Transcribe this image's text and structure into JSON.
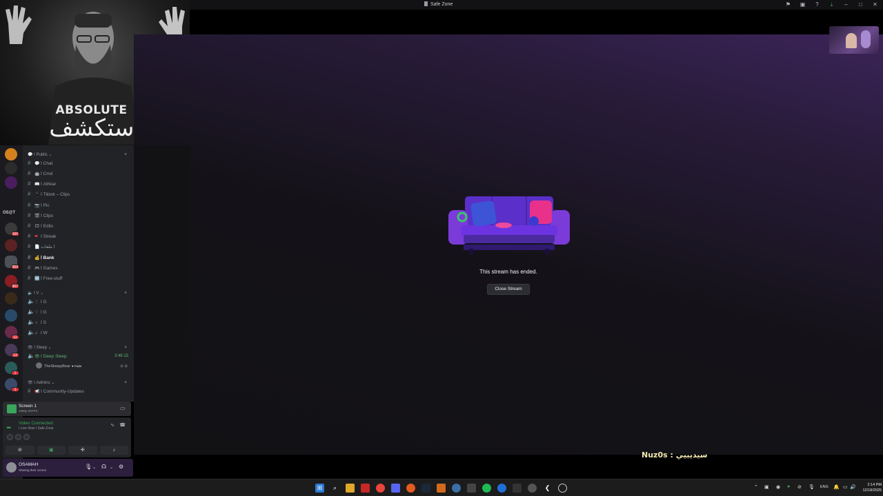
{
  "window": {
    "title": "Safe Zone",
    "title_icons": [
      "pin-icon",
      "inbox-icon",
      "help-icon",
      "download-icon",
      "minimize-icon",
      "maximize-icon",
      "close-icon"
    ]
  },
  "webcam": {
    "caption_en": "ABSOLUTE",
    "caption_ar": "استكشف"
  },
  "stream": {
    "ended_message": "This stream has ended.",
    "close_button": "Close Stream",
    "bottom_overlay": "Nuz0s : سيديبيي"
  },
  "server_rail": {
    "label_text": "OS@T",
    "badges": [
      "160",
      "359",
      "307",
      "11",
      "13",
      "1",
      "1"
    ]
  },
  "channels": {
    "public_category": "ا Public",
    "text_channels": [
      {
        "emoji": "💬",
        "name": "ا Chat"
      },
      {
        "emoji": "🤖",
        "name": "ا Cmd"
      },
      {
        "emoji": "📖",
        "name": "ا Athkar"
      },
      {
        "emoji": "📱",
        "name": "ا Tiktok – Clips"
      },
      {
        "emoji": "📷",
        "name": "ا Pic"
      },
      {
        "emoji": "🎬",
        "name": "ا Clips"
      },
      {
        "emoji": "🎞",
        "name": "ا Edits"
      },
      {
        "emoji": "❤",
        "name": "ا Streak"
      },
      {
        "emoji": "📄",
        "name": "ا ملفات"
      },
      {
        "emoji": "💰",
        "name": "ا Bank"
      },
      {
        "emoji": "🎮",
        "name": "ا Games"
      },
      {
        "emoji": "🆓",
        "name": "ا Free-stuff"
      }
    ],
    "v_category": "ا V",
    "voice_channels": [
      {
        "emoji": "♡",
        "name": "ا G"
      },
      {
        "emoji": "♡",
        "name": "ا G"
      },
      {
        "emoji": "☆",
        "name": "ا S"
      },
      {
        "emoji": "♫",
        "name": "ا W"
      }
    ],
    "sleep_category": "ا Sleep",
    "sleep_channel": {
      "name": "ا Deep Sleep",
      "timer": "3:48:15"
    },
    "sleep_user": {
      "name": "TheSleepyBear",
      "tag": "♥ Fade"
    },
    "admins_category": "ا Admins",
    "admin_channel": {
      "name": "ا Community-Updates"
    }
  },
  "screen_share": {
    "title": "Screen 1",
    "subtitle": "1080p 30FPS"
  },
  "voice": {
    "status": "Video Connected",
    "location": "ا Live Now / Safe Zone"
  },
  "user": {
    "name": "OSAMAH",
    "status": "Sharing their screen"
  },
  "taskbar": {
    "language": "ENG",
    "time": "2:14 PM",
    "date": "12/18/2025"
  },
  "colors": {
    "accent_green": "#3ba55c",
    "stream_purple": "#3c2459",
    "badge_red": "#da373c"
  }
}
